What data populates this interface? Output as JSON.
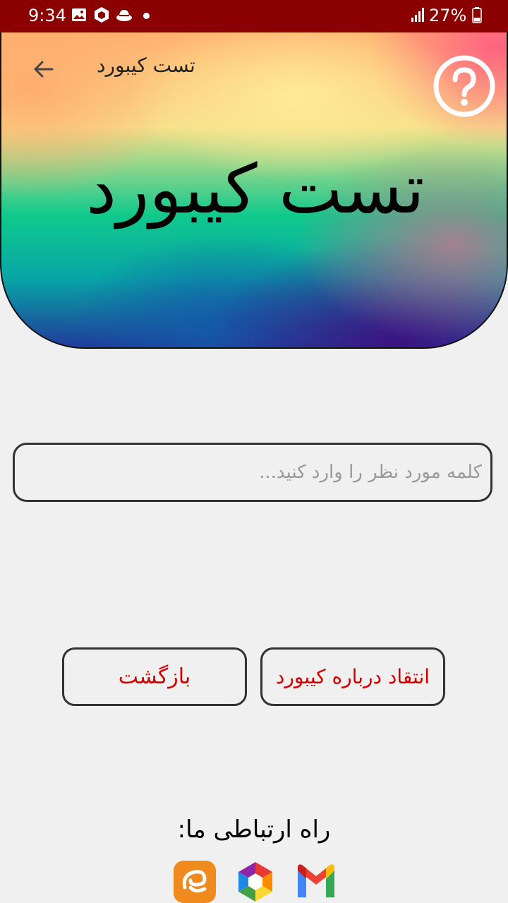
{
  "status_bar": {
    "time": "9:34",
    "battery": "27%",
    "icons": [
      "image-icon",
      "app-hexagon-icon",
      "hat-icon",
      "notification-dot-icon",
      "signal-icon",
      "battery-icon"
    ]
  },
  "header": {
    "title": "تست کیبورد",
    "hero_title": "تست کیبورد",
    "back_icon": "back-arrow-icon",
    "help_icon": "help-icon"
  },
  "input": {
    "value": "",
    "placeholder": "کلمه مورد نظر را وارد کنید..."
  },
  "buttons": {
    "feedback_label": "انتقاد درباره کیبورد",
    "back_label": "بازگشت"
  },
  "contact": {
    "label": "راه ارتباطی ما:",
    "icons": [
      "eitaa-icon",
      "rubika-icon",
      "gmail-icon"
    ]
  },
  "colors": {
    "status_bar": "#8b0000",
    "background": "#f0f0f0",
    "button_text": "#d40000"
  }
}
